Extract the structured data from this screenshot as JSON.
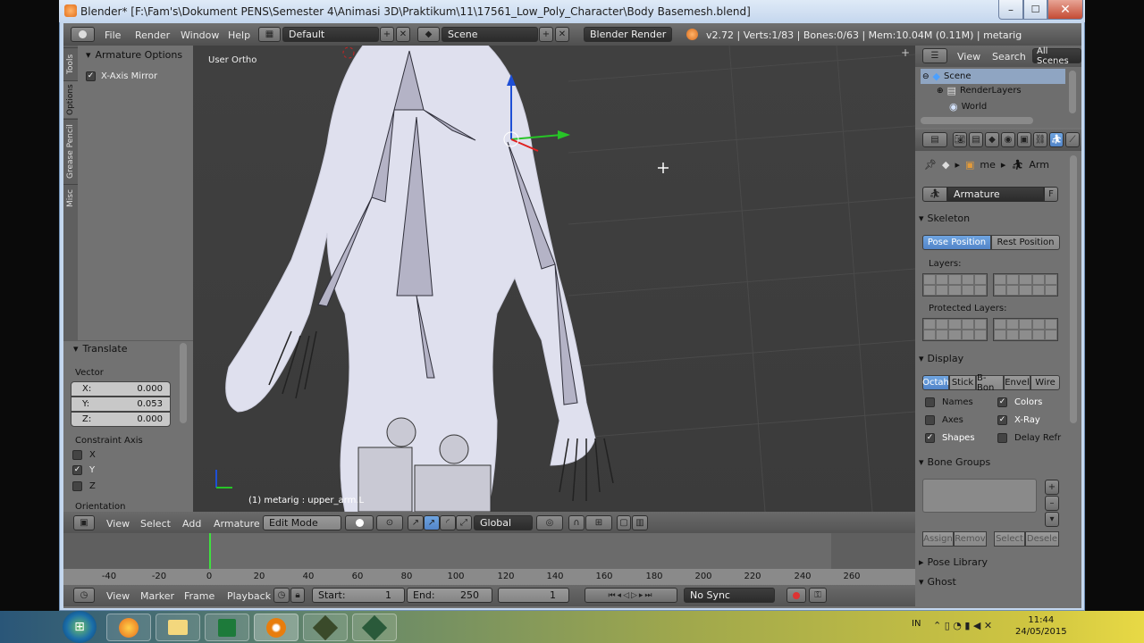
{
  "window": {
    "title": "Blender* [F:\\Fam's\\Dokument PENS\\Semester 4\\Animasi 3D\\Praktikum\\11\\17561_Low_Poly_Character\\Body Basemesh.blend]",
    "close_glyph": "✕",
    "min_glyph": "–",
    "max_glyph": "☐"
  },
  "info_header": {
    "menus": [
      "File",
      "Render",
      "Window",
      "Help"
    ],
    "layout_name": "Default",
    "scene_name": "Scene",
    "render_engine": "Blender Render",
    "stats": "v2.72 | Verts:1/83 | Bones:0/63 | Mem:10.04M (0.11M) | metarig"
  },
  "tool_shelf": {
    "tabs": [
      "Tools",
      "Options",
      "Grease Pencil",
      "Misc"
    ],
    "panel_title": "Armature Options",
    "x_axis_mirror_label": "X-Axis Mirror",
    "x_axis_mirror_checked": true
  },
  "redo_panel": {
    "title": "Translate",
    "vector_label": "Vector",
    "fields": [
      {
        "label": "X:",
        "value": "0.000"
      },
      {
        "label": "Y:",
        "value": "0.053"
      },
      {
        "label": "Z:",
        "value": "0.000"
      }
    ],
    "constraint_label": "Constraint Axis",
    "axes": [
      {
        "label": "X",
        "checked": false
      },
      {
        "label": "Y",
        "checked": true
      },
      {
        "label": "Z",
        "checked": false
      }
    ],
    "orientation_label": "Orientation"
  },
  "viewport": {
    "view_name": "User Ortho",
    "object_info": "(1) metarig : upper_arm.L"
  },
  "viewport_header": {
    "menus": [
      "View",
      "Select",
      "Add",
      "Armature"
    ],
    "mode": "Edit Mode",
    "orientation": "Global"
  },
  "timeline": {
    "ticks": [
      "-40",
      "-20",
      "0",
      "20",
      "40",
      "60",
      "80",
      "100",
      "120",
      "140",
      "160",
      "180",
      "200",
      "220",
      "240",
      "260"
    ],
    "menus": [
      "View",
      "Marker",
      "Frame",
      "Playback"
    ],
    "start_label": "Start:",
    "start_value": "1",
    "end_label": "End:",
    "end_value": "250",
    "current_frame": "1",
    "sync": "No Sync"
  },
  "outliner": {
    "menus": [
      "View",
      "Search"
    ],
    "filter": "All Scenes",
    "tree": [
      "Scene",
      "RenderLayers",
      "World"
    ]
  },
  "properties": {
    "breadcrumb": [
      "me",
      "Arm"
    ],
    "datablock_name": "Armature",
    "datablock_flag": "F",
    "skeleton": {
      "title": "Skeleton",
      "pose_position": "Pose Position",
      "rest_position": "Rest Position",
      "layers_label": "Layers:",
      "protected_label": "Protected Layers:"
    },
    "display": {
      "title": "Display",
      "types": [
        "Octah",
        "Stick",
        "B-Bon",
        "Envel",
        "Wire"
      ],
      "options_left": [
        {
          "label": "Names",
          "checked": false
        },
        {
          "label": "Axes",
          "checked": false
        },
        {
          "label": "Shapes",
          "checked": true
        }
      ],
      "options_right": [
        {
          "label": "Colors",
          "checked": true
        },
        {
          "label": "X-Ray",
          "checked": true
        },
        {
          "label": "Delay Refr",
          "checked": false
        }
      ]
    },
    "bone_groups": {
      "title": "Bone Groups",
      "buttons": [
        "Assign",
        "Remov",
        "Select",
        "Desele"
      ]
    },
    "pose_library": "Pose Library",
    "ghost": "Ghost"
  },
  "taskbar": {
    "time": "11:44",
    "date": "24/05/2015",
    "lang": "IN"
  }
}
